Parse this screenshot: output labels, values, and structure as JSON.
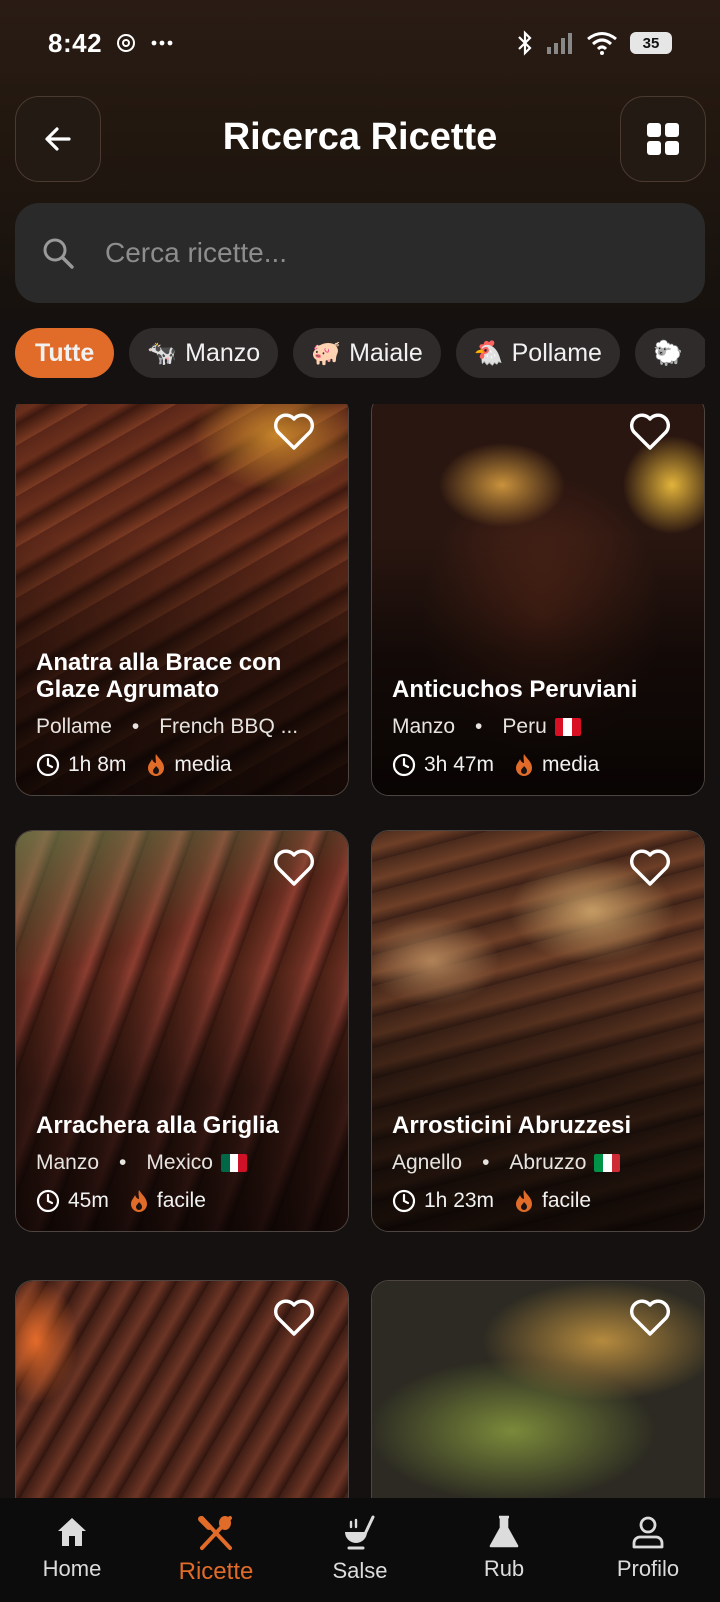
{
  "status_bar": {
    "time": "8:42",
    "battery": "35"
  },
  "header": {
    "title": "Ricerca Ricette"
  },
  "search": {
    "placeholder": "Cerca ricette..."
  },
  "chips": [
    {
      "label": "Tutte",
      "icon": ""
    },
    {
      "label": "Manzo",
      "icon": "🐄"
    },
    {
      "label": "Maiale",
      "icon": "🐖"
    },
    {
      "label": "Pollame",
      "icon": "🐔"
    },
    {
      "label": "",
      "icon": "🐑"
    }
  ],
  "recipes": [
    {
      "title": "Anatra alla Brace con Glaze Agrumato",
      "category": "Pollame",
      "origin": "French BBQ ...",
      "time": "1h 8m",
      "difficulty": "media"
    },
    {
      "title": "Anticuchos Peruviani",
      "category": "Manzo",
      "origin": "Peru",
      "time": "3h 47m",
      "difficulty": "media"
    },
    {
      "title": "Arrachera alla Griglia",
      "category": "Manzo",
      "origin": "Mexico",
      "time": "45m",
      "difficulty": "facile"
    },
    {
      "title": "Arrosticini Abruzzesi",
      "category": "Agnello",
      "origin": "Abruzzo",
      "time": "1h 23m",
      "difficulty": "facile"
    }
  ],
  "separator": "•",
  "nav": [
    {
      "label": "Home",
      "icon": "home-icon"
    },
    {
      "label": "Ricette",
      "icon": "utensils-icon"
    },
    {
      "label": "Salse",
      "icon": "sauce-icon"
    },
    {
      "label": "Rub",
      "icon": "flask-icon"
    },
    {
      "label": "Profilo",
      "icon": "profile-icon"
    }
  ],
  "colors": {
    "accent": "#e16b28",
    "background": "#141110",
    "surface": "#2a2a2a"
  }
}
